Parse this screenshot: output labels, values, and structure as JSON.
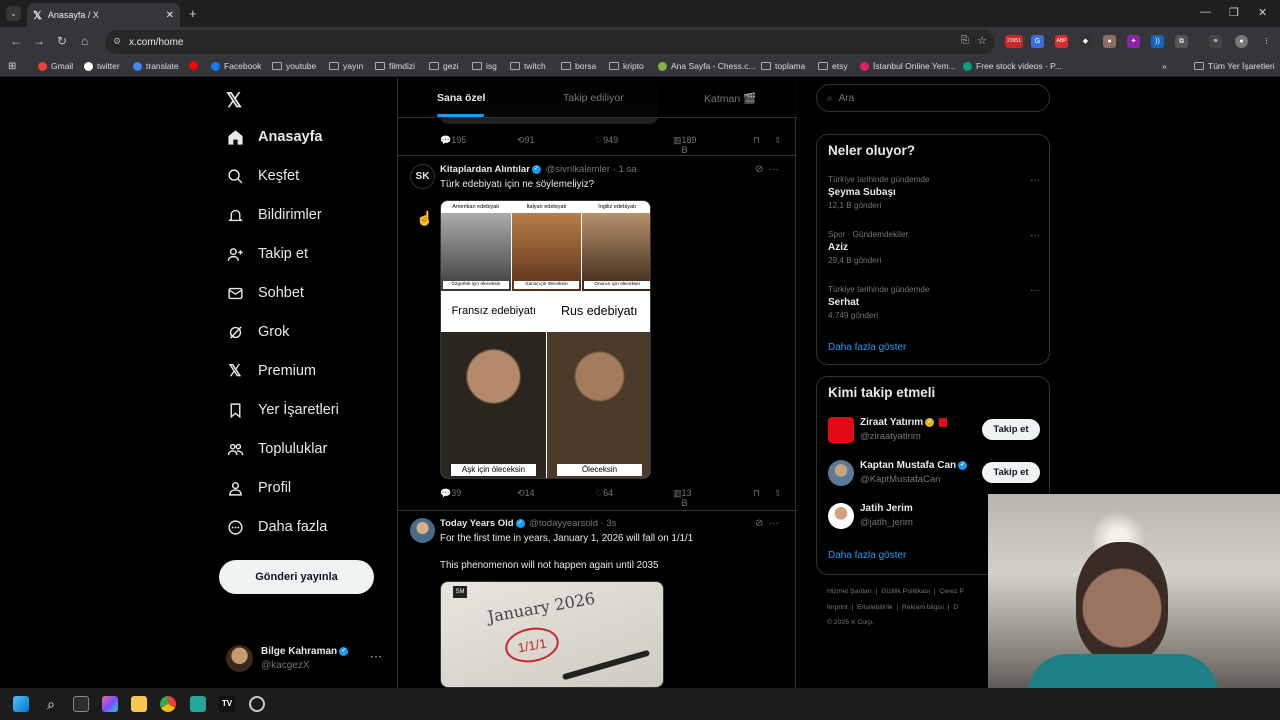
{
  "browser": {
    "tab_title": "Anasayfa / X",
    "tab_close": "✕",
    "new_tab": "+",
    "url": "x.com/home",
    "ext_badge": "23951",
    "bookmarks": [
      "Gmail",
      "twitter",
      "translate",
      "Facebook",
      "youtube",
      "yayın",
      "filmdizi",
      "gezi",
      "isg",
      "twitch",
      "borsa",
      "kripto",
      "Ana Sayfa - Chess.c...",
      "toplama",
      "etsy",
      "İstanbul Online Yem...",
      "Free stock videos - P..."
    ],
    "all_bookmarks": "Tüm Yer İşaretleri"
  },
  "nav": {
    "items": [
      "Anasayfa",
      "Keşfet",
      "Bildirimler",
      "Takip et",
      "Sohbet",
      "Grok",
      "Premium",
      "Yer İşaretleri",
      "Topluluklar",
      "Profil",
      "Daha fazla"
    ],
    "post_button": "Gönderi yayınla",
    "account_name": "Bilge Kahraman",
    "account_handle": "@kacgezX",
    "more": "···"
  },
  "feed": {
    "tabs": [
      "Sana özel",
      "Takip ediliyor",
      "Katman 🎬"
    ],
    "prev_actions": {
      "reply": "195",
      "repost": "91",
      "like": "949",
      "views": "189 B"
    },
    "tweet1": {
      "name": "Kitaplardan Alıntılar",
      "handle": "@sivrilkalemler",
      "time": "· 1 sa",
      "text": "Türk edebiyatı için ne söylemeliyiz?",
      "avatar_text": "SK",
      "meme": {
        "top": [
          "Amerikan edebiyatı",
          "İtalyan edebiyatı",
          "İngiliz edebiyatı"
        ],
        "top_caps": [
          "Özgürlük için öleceksin",
          "Sanat için öleceksin",
          "Onurun için öleceksin"
        ],
        "mid": [
          "Fransız edebiyatı",
          "Rus edebiyatı"
        ],
        "bottom_caps": [
          "Aşk için öleceksin",
          "Öleceksin"
        ]
      },
      "actions": {
        "reply": "39",
        "repost": "14",
        "like": "64",
        "views": "13 B"
      }
    },
    "tweet2": {
      "name": "Today Years Old",
      "handle": "@todayyearsold",
      "time": "· 3s",
      "text1": "For the first time in years, January 1, 2026 will fall on 1/1/1",
      "text2": "This phenomenon will not happen again until 2035",
      "cal_title": "January 2026",
      "cal_mark": "1/1/1",
      "cal_logo": "SM"
    }
  },
  "sidebar": {
    "search_placeholder": "Ara",
    "trends_title": "Neler oluyor?",
    "trends": [
      {
        "ctx": "Türkiye tarihinde gündemde",
        "topic": "Şeyma Subaşı",
        "count": "12,1 B gönderi"
      },
      {
        "ctx": "Spor · Gündemdekiler",
        "topic": "Aziz",
        "count": "29,4 B gönderi"
      },
      {
        "ctx": "Türkiye tarihinde gündemde",
        "topic": "Serhat",
        "count": "4.749 gönderi"
      }
    ],
    "show_more": "Daha fazla göster",
    "who_title": "Kimi takip etmeli",
    "who": [
      {
        "name": "Ziraat Yatırım",
        "handle": "@ziraatyatirim",
        "btn": "Takip et"
      },
      {
        "name": "Kaptan Mustafa Can",
        "handle": "@KaptMustafaCan",
        "btn": "Takip et"
      },
      {
        "name": "Jatih Jerim",
        "handle": "@jatih_jerim",
        "btn": ""
      }
    ],
    "footer": [
      "Hizmet Şartları",
      "Gizlilik Politikası",
      "Çerez P",
      "İmprint",
      "Erişilebilirlik",
      "Reklam bilgisi",
      "D"
    ],
    "copyright": "© 2025 X Corp."
  },
  "colors": {
    "accent": "#1d9bf0",
    "bg": "#000000",
    "border": "#2f3336",
    "muted": "#71767b"
  }
}
